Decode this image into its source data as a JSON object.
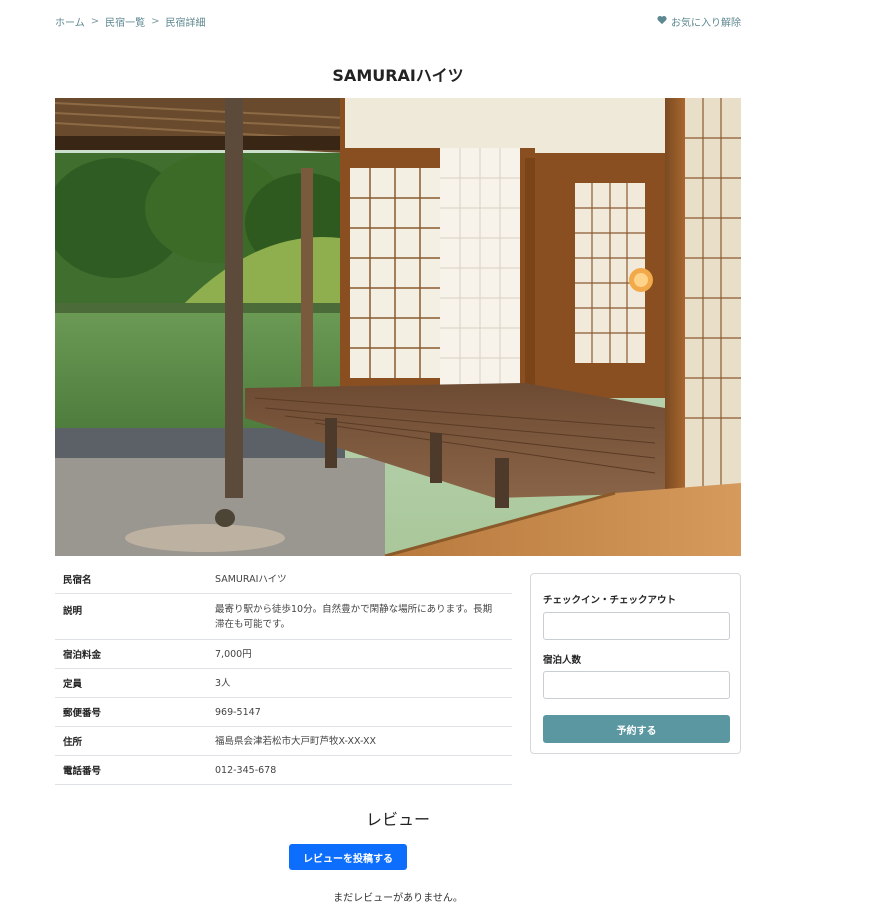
{
  "breadcrumb": {
    "home": "ホーム",
    "list": "民宿一覧",
    "detail": "民宿詳細",
    "separator": ">"
  },
  "favorite": {
    "label": "お気に入り解除",
    "icon": "heart-icon"
  },
  "inn": {
    "title": "SAMURAIハイツ",
    "image_alt": "SAMURAIハイツ",
    "details": [
      {
        "label": "民宿名",
        "value": "SAMURAIハイツ"
      },
      {
        "label": "説明",
        "value": "最寄り駅から徒歩10分。自然豊かで閑静な場所にあります。長期滞在も可能です。"
      },
      {
        "label": "宿泊料金",
        "value": "7,000円"
      },
      {
        "label": "定員",
        "value": "3人"
      },
      {
        "label": "郵便番号",
        "value": "969-5147"
      },
      {
        "label": "住所",
        "value": "福島県会津若松市大戸町芦牧X-XX-XX"
      },
      {
        "label": "電話番号",
        "value": "012-345-678"
      }
    ]
  },
  "reservation": {
    "checkin_label": "チェックイン・チェックアウト",
    "checkin_value": "",
    "guests_label": "宿泊人数",
    "guests_value": "",
    "submit_label": "予約する"
  },
  "reviews": {
    "title": "レビュー",
    "post_button": "レビューを投稿する",
    "empty_message": "まだレビューがありません。"
  },
  "colors": {
    "accent": "#5a97a0",
    "primary": "#0d6efd",
    "link": "#5e8891"
  }
}
